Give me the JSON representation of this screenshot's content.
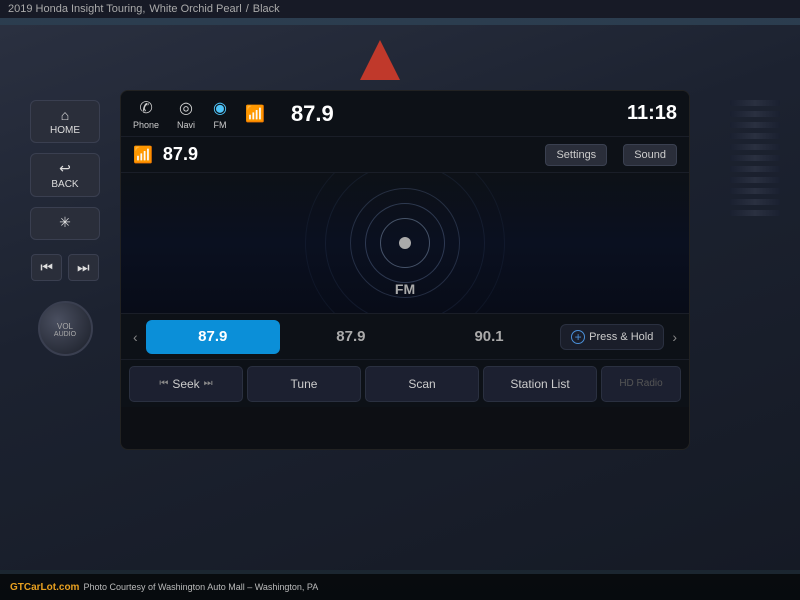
{
  "header": {
    "title": "2019 Honda Insight Touring,",
    "color": "White Orchid Pearl",
    "trim": "Black"
  },
  "topbar_icons": [
    {
      "id": "phone",
      "label": "Phone",
      "symbol": "📞"
    },
    {
      "id": "navi",
      "label": "Navi",
      "symbol": "⊙"
    },
    {
      "id": "fm",
      "label": "FM",
      "symbol": "⊚",
      "active": true
    }
  ],
  "frequency_display": "87.9",
  "time": "11:18",
  "row2_freq": "87.9",
  "buttons": {
    "settings": "Settings",
    "sound": "Sound",
    "seek": "Seek",
    "tune": "Tune",
    "scan": "Scan",
    "station_list": "Station List",
    "press_hold": "Press & Hold",
    "hdradio": "HD Radio"
  },
  "freq_stations": [
    {
      "value": "87.9",
      "active": true
    },
    {
      "value": "87.9",
      "active": false
    },
    {
      "value": "90.1",
      "active": false
    }
  ],
  "fm_label": "FM",
  "photo_credit": "Photo Courtesy of Washington Auto Mall – Washington, PA",
  "logo": "GTCarLot.com",
  "sidebar_labels": {
    "home": "HOME",
    "back": "BACK"
  },
  "controls": {
    "vol": "VOL",
    "audio": "AUDIO"
  }
}
